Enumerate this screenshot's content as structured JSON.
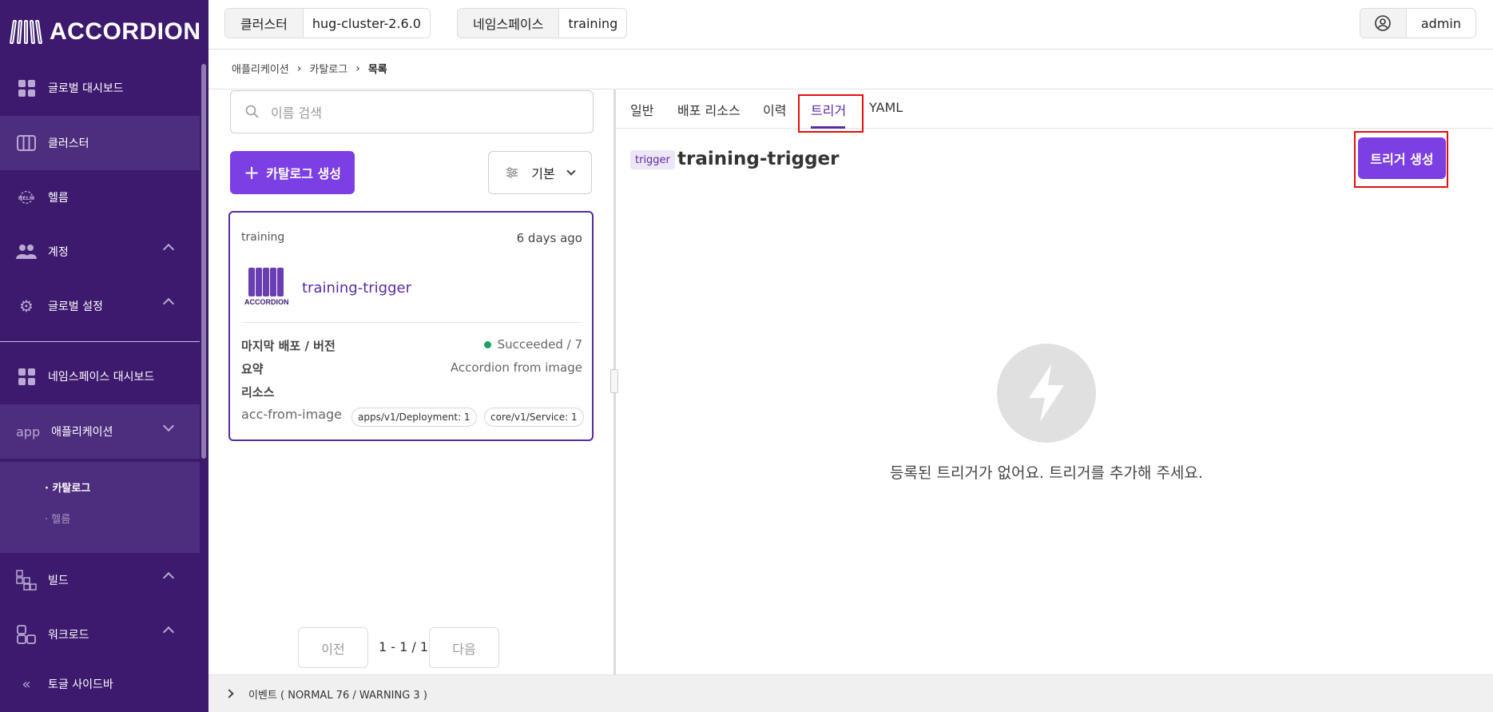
{
  "app": {
    "logo_text": "ACCORDION"
  },
  "topbar": {
    "cluster_label": "클러스터",
    "cluster_value": "hug-cluster-2.6.0",
    "namespace_label": "네임스페이스",
    "namespace_value": "training",
    "user": "admin"
  },
  "sidebar": {
    "items": [
      {
        "label": "글로벌 대시보드",
        "icon": "grid-icon"
      },
      {
        "label": "클러스터",
        "icon": "columns-icon"
      },
      {
        "label": "헬름",
        "icon": "helm-icon"
      },
      {
        "label": "계정",
        "icon": "users-icon"
      },
      {
        "label": "글로벌 설정",
        "icon": "gear-icon"
      },
      {
        "label": "네임스페이스 대시보드",
        "icon": "grid-icon"
      },
      {
        "label": "애플리케이션",
        "icon_text": "app"
      },
      {
        "label": "빌드",
        "icon": "build-icon"
      },
      {
        "label": "워크로드",
        "icon": "workload-icon"
      }
    ],
    "sub_items": [
      "· 카탈로그",
      "· 헬름"
    ],
    "toggle_label": "토글 사이드바"
  },
  "breadcrumb": {
    "items": [
      "애플리케이션",
      "카탈로그",
      "목록"
    ]
  },
  "list_panel": {
    "search_placeholder": "이름 검색",
    "create_button": "카탈로그 생성",
    "sort_label": "기본",
    "card": {
      "namespace": "training",
      "age": "6 days ago",
      "logo_text": "ACCORDION",
      "title": "training-trigger",
      "last_deploy_label": "마지막 배포 / 버전",
      "last_deploy_value": "Succeeded / 7",
      "summary_label": "요약",
      "summary_value": "Accordion from image",
      "resources_label": "리소스",
      "resource_name": "acc-from-image",
      "tags": [
        "apps/v1/Deployment: 1",
        "core/v1/Service: 1"
      ]
    },
    "pager": {
      "prev": "이전",
      "info": "1 - 1 / 1",
      "next": "다음"
    }
  },
  "detail_panel": {
    "tabs": [
      "일반",
      "배포 리소스",
      "이력",
      "트리거",
      "YAML"
    ],
    "active_tab": "트리거",
    "chip": "trigger",
    "title": "training-trigger",
    "create_trigger_button": "트리거 생성",
    "empty_message": "등록된 트리거가 없어요. 트리거를 추가해 주세요."
  },
  "events": {
    "label": "이벤트 ( NORMAL 76 / WARNING 3 )"
  },
  "colors": {
    "sidebar": "#3d1a6e",
    "accent": "#7b3fe4",
    "highlight_box": "#e01010",
    "success": "#1aa260"
  }
}
